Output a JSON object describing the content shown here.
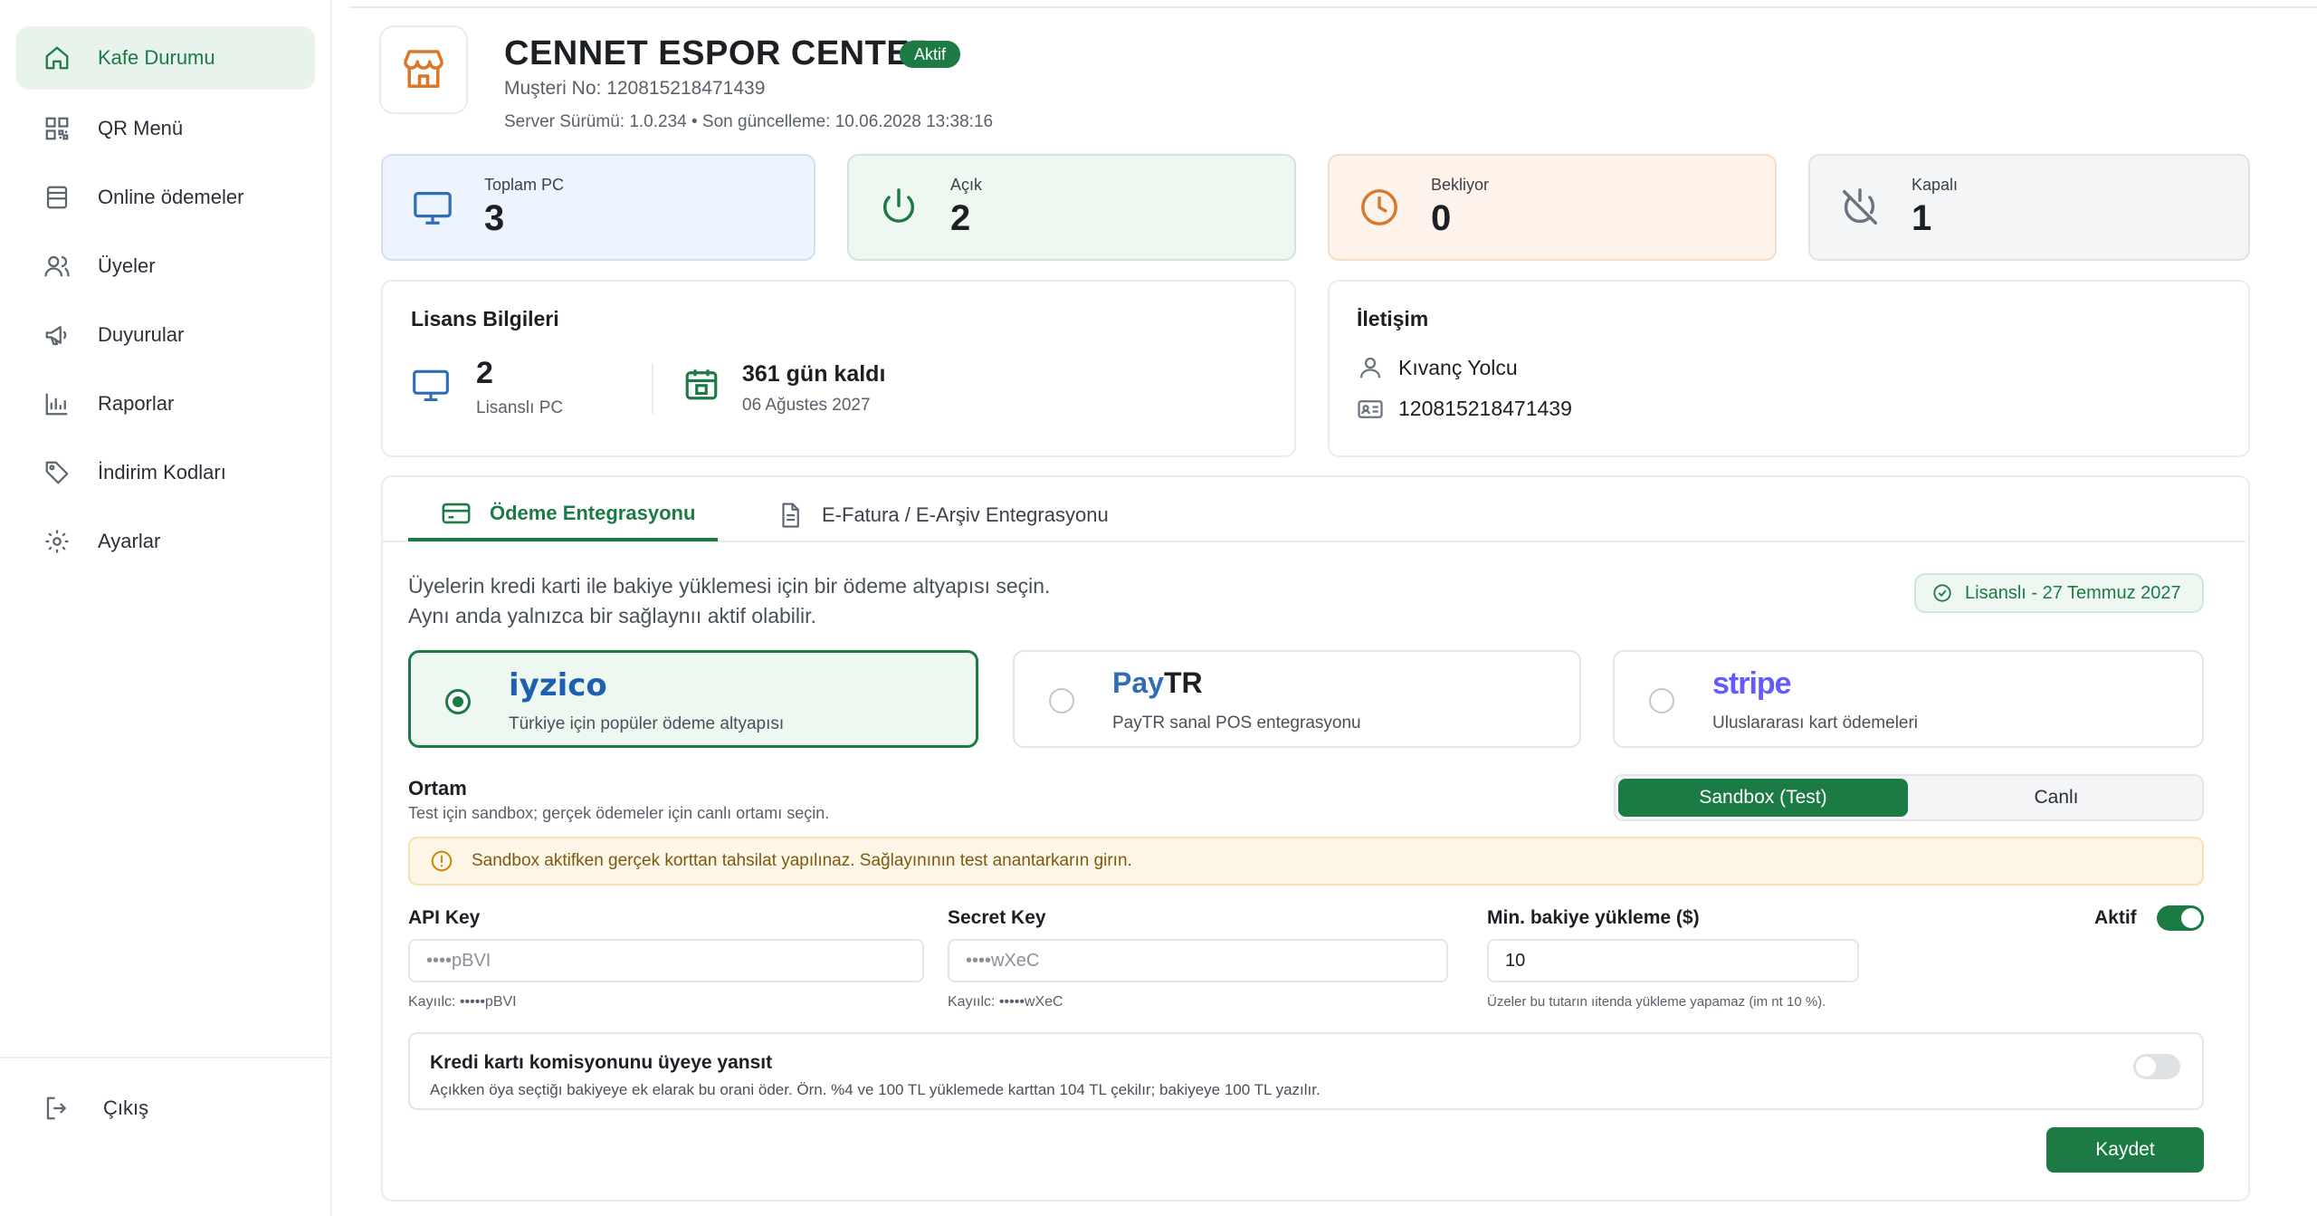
{
  "sidebar": {
    "items": [
      {
        "label": "Kafe Durumu",
        "icon": "home-icon",
        "active": true
      },
      {
        "label": "QR Menü",
        "icon": "qr-icon"
      },
      {
        "label": "Online ödemeler",
        "icon": "receipt-icon"
      },
      {
        "label": "Üyeler",
        "icon": "users-icon"
      },
      {
        "label": "Duyurular",
        "icon": "megaphone-icon"
      },
      {
        "label": "Raporlar",
        "icon": "bar-chart-icon"
      },
      {
        "label": "İndirim Kodları",
        "icon": "tag-icon"
      },
      {
        "label": "Ayarlar",
        "icon": "gear-icon"
      }
    ],
    "logout_label": "Çıkış"
  },
  "header": {
    "title": "CENNET ESPOR CENTER",
    "status_badge": "Aktif",
    "customer_no": "Muşteri No: 120815218471439",
    "server_info": "Server Sürümü: 1.0.234  •  Son güncelleme: 10.06.2028 13:38:16"
  },
  "stats": [
    {
      "label": "Toplam PC",
      "value": "3",
      "icon": "monitor-icon",
      "color": "#2f6db5"
    },
    {
      "label": "Açık",
      "value": "2",
      "icon": "power-icon",
      "color": "#1c7a45"
    },
    {
      "label": "Bekliyor",
      "value": "0",
      "icon": "clock-icon",
      "color": "#d9782b"
    },
    {
      "label": "Kapalı",
      "value": "1",
      "icon": "power-off-icon",
      "color": "#6b7280"
    }
  ],
  "license": {
    "title": "Lisans Bilgileri",
    "pc_count": "2",
    "pc_label": "Lisanslı PC",
    "days_left": "361 gün kaldı",
    "expiry": "06 Ağustes 2027"
  },
  "contact": {
    "title": "İletişim",
    "name": "Kıvanç Yolcu",
    "id_no": "120815218471439"
  },
  "tabs": [
    {
      "label": "Ödeme Entegrasyonu",
      "active": true
    },
    {
      "label": "E-Fatura / E-Arşiv Entegrasyonu",
      "active": false
    }
  ],
  "payment": {
    "description_line1": "Üyelerin kredi karti ile bakiye yüklemesi için bir ödeme altyapısı seçin.",
    "description_line2": "Aynı anda yalnızca bir sağlaynıı aktif olabilir.",
    "license_badge": "Lisanslı - 27 Temmuz 2027",
    "providers": [
      {
        "brand": "iyzico",
        "subtitle": "Türkiye için popüler ödeme altyapısı",
        "selected": true,
        "brand_color": "#1f5fb0"
      },
      {
        "brand_a": "Pay",
        "brand_b": "TR",
        "subtitle": "PayTR sanal POS entegrasyonu",
        "selected": false,
        "brand_color": "#2f6db5"
      },
      {
        "brand": "stripe",
        "subtitle": "Uluslararası kart ödemeleri",
        "selected": false,
        "brand_color": "#635bff"
      }
    ],
    "environment": {
      "title": "Ortam",
      "subtitle": "Test için sandbox; gerçek ödemeler için canlı ortamı seçin.",
      "options": [
        "Sandbox (Test)",
        "Canlı"
      ],
      "selected": "Sandbox (Test)"
    },
    "warning": "Sandbox aktifken gerçek korttan tahsilat yapılınaz. Sağlayınının test anantarkarın girın.",
    "api_key": {
      "label": "API Key",
      "placeholder": "••••pBVI",
      "hint": "Kayıılc: •••••pBVI"
    },
    "secret_key": {
      "label": "Secret Key",
      "placeholder": "••••wXeC",
      "hint": "Kayıılc: •••••wXeC"
    },
    "min_topup": {
      "label": "Min. bakiye yükleme ($)",
      "value": "10",
      "hint": "Üzeler bu tutarın ıitenda yükleme yapamaz (im nt 10 %)."
    },
    "active_label": "Aktif",
    "active_on": true,
    "commission": {
      "title": "Kredi kartı komisyonunu üyeye yansıt",
      "subtitle": "Açıkken öya seçtiğı bakiyeye ek elarak bu orani öder. Örn. %4 ve 100 TL yüklemede karttan 104 TL çekilır; bakiyeye 100 TL yazılır.",
      "on": false
    },
    "save_label": "Kaydet"
  }
}
